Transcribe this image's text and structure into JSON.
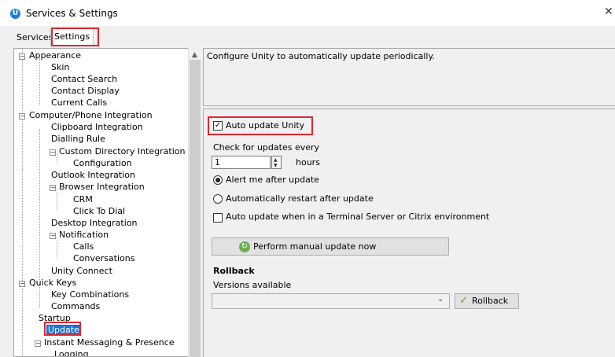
{
  "window": {
    "title": "Services & Settings",
    "app_icon_letter": "U",
    "close_glyph": "✕"
  },
  "tabs": [
    {
      "label": "Services"
    },
    {
      "label": "Settings"
    }
  ],
  "tree": {
    "items": [
      {
        "label": "Appearance"
      },
      {
        "label": "Skin"
      },
      {
        "label": "Contact Search"
      },
      {
        "label": "Contact Display"
      },
      {
        "label": "Current Calls"
      },
      {
        "label": "Computer/Phone Integration"
      },
      {
        "label": "Clipboard Integration"
      },
      {
        "label": "Dialling Rule"
      },
      {
        "label": "Custom Directory Integration"
      },
      {
        "label": "Configuration"
      },
      {
        "label": "Outlook Integration"
      },
      {
        "label": "Browser Integration"
      },
      {
        "label": "CRM"
      },
      {
        "label": "Click To Dial"
      },
      {
        "label": "Desktop Integration"
      },
      {
        "label": "Notification"
      },
      {
        "label": "Calls"
      },
      {
        "label": "Conversations"
      },
      {
        "label": "Unity Connect"
      },
      {
        "label": "Quick Keys"
      },
      {
        "label": "Key Combinations"
      },
      {
        "label": "Commands"
      },
      {
        "label": "Startup"
      },
      {
        "label": "Update"
      },
      {
        "label": "Instant Messaging & Presence"
      },
      {
        "label": "Logging"
      }
    ]
  },
  "description": "Configure Unity to automatically update periodically.",
  "update": {
    "auto_update_label": "Auto update Unity",
    "auto_update_checked": true,
    "check_every_label": "Check for updates every",
    "interval_value": "1",
    "interval_unit": "hours",
    "alert_label": "Alert me after update",
    "restart_label": "Automatically restart after update",
    "terminal_label": "Auto update when in a Terminal Server or Citrix environment",
    "manual_button": "Perform manual update now"
  },
  "rollback": {
    "heading": "Rollback",
    "versions_label": "Versions available",
    "versions_value": "",
    "button": "Rollback"
  },
  "icons": {
    "app": "unity-logo-icon",
    "refresh": "refresh-icon",
    "check": "check-icon",
    "chevron": "chevron-down-icon"
  },
  "colors": {
    "highlight": "#e0262d",
    "selection": "#1e72d4",
    "accent": "#1f7de2"
  }
}
